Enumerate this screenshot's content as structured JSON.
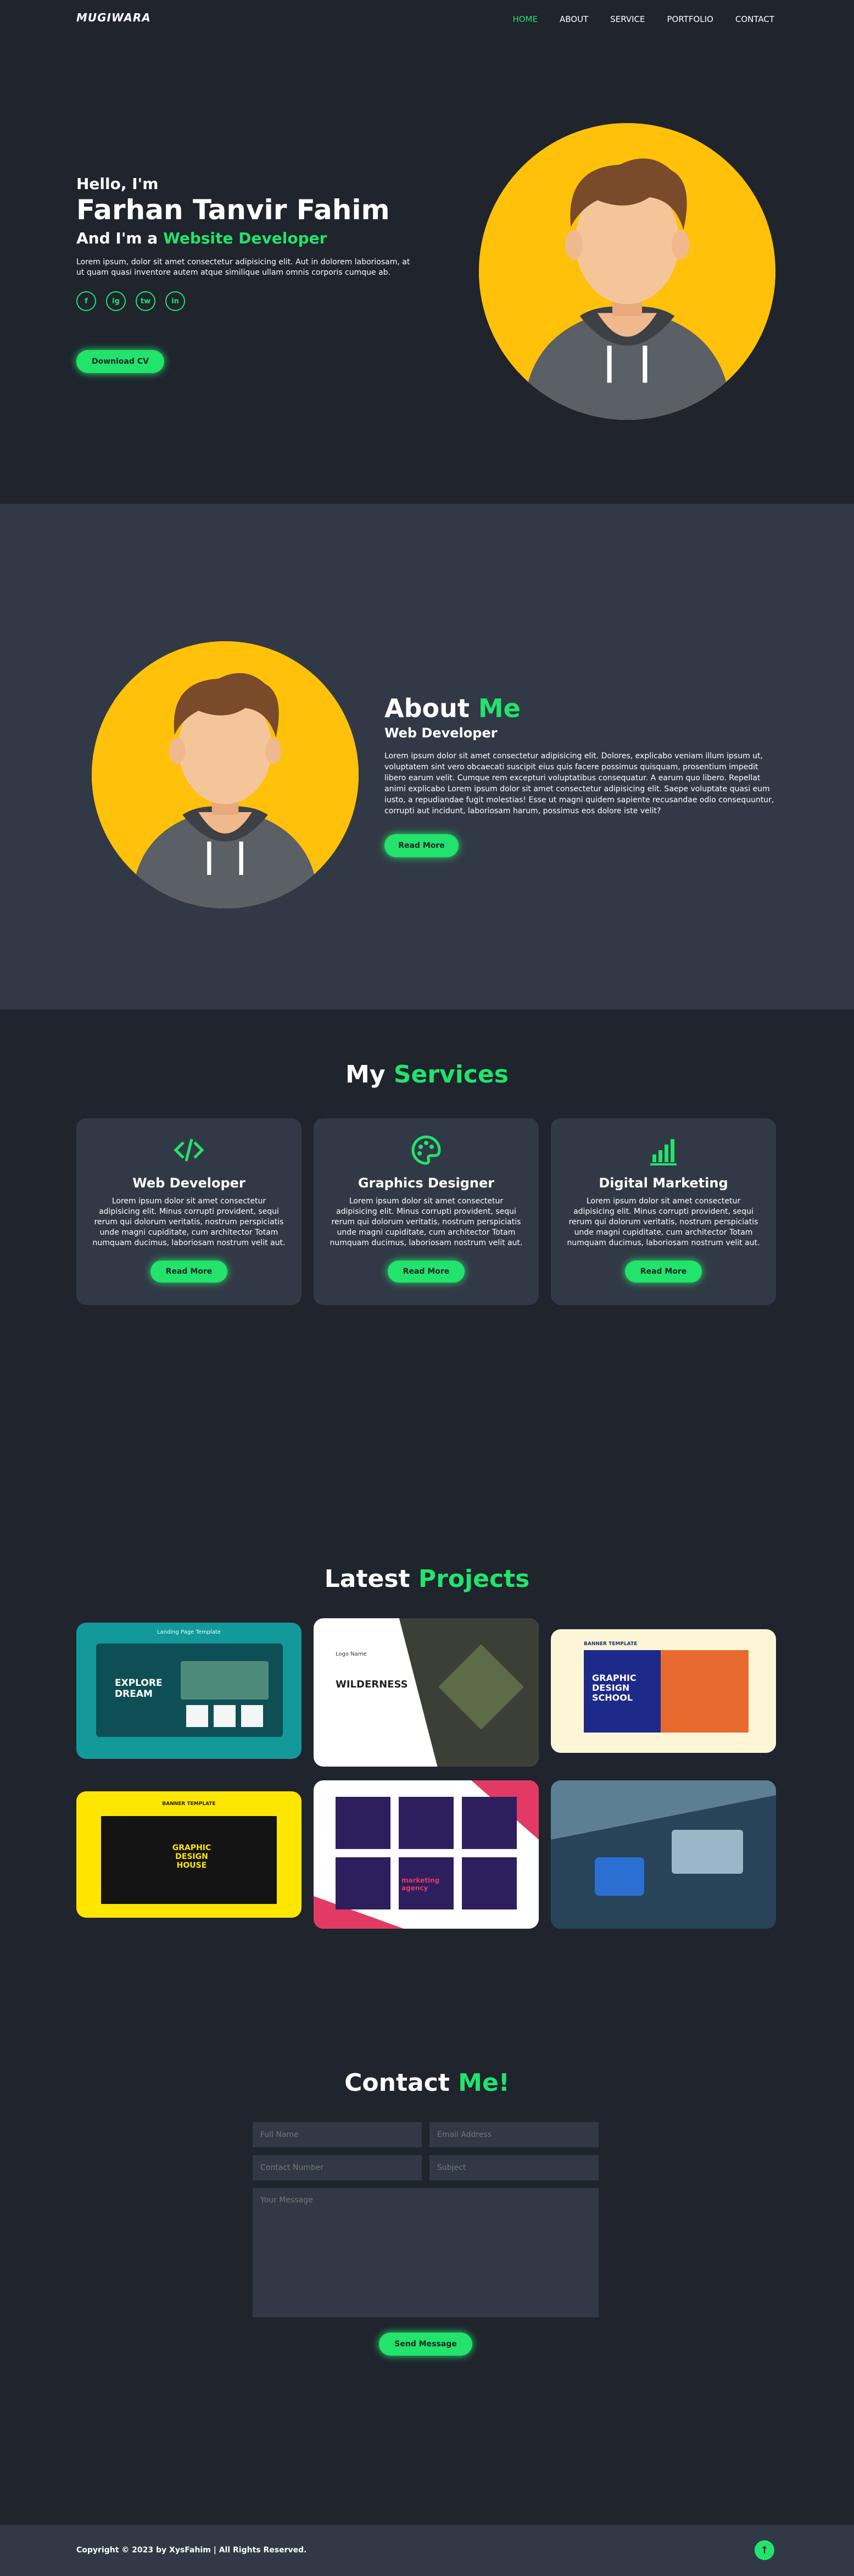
{
  "header": {
    "logo": "MUGIWARA",
    "nav": [
      "HOME",
      "ABOUT",
      "SERVICE",
      "PORTFOLIO",
      "CONTACT"
    ]
  },
  "hero": {
    "hello": "Hello, I'm",
    "name": "Farhan Tanvir Fahim",
    "role_prefix": "And I'm a",
    "role": "Website Developer",
    "description": "Lorem ipsum, dolor sit amet consectetur adipisicing elit. Aut in dolorem laboriosam, at ut quam quasi inventore autem atque similique ullam omnis corporis cumque ab.",
    "socials": [
      "f",
      "ig",
      "tw",
      "in"
    ],
    "cta": "Download CV"
  },
  "about": {
    "title_a": "About",
    "title_b": "Me",
    "subtitle": "Web Developer",
    "description": "Lorem ipsum dolor sit amet consectetur adipisicing elit. Dolores, explicabo veniam illum ipsum ut, voluptatem sint vero obcaecati suscipit eius quis facere possimus quisquam, prosentium impedit libero earum velit. Cumque rem excepturi voluptatibus consequatur. A earum quo libero. Repellat animi explicabo Lorem ipsum dolor sit amet consectetur adipisicing elit. Saepe voluptate quasi eum iusto, a repudiandae fugit molestias! Esse ut magni quidem sapiente recusandae odio consequuntur, corrupti aut incidunt, laboriosam harum, possimus eos dolore iste velit?",
    "cta": "Read More"
  },
  "services": {
    "title_a": "My",
    "title_b": "Services",
    "cards": [
      {
        "title": "Web Developer",
        "icon": "code-icon",
        "desc": "Lorem ipsum dolor sit amet consectetur adipisicing elit. Minus corrupti provident, sequi rerum qui dolorum veritatis, nostrum perspiciatis unde magni cupiditate, cum architector Totam numquam ducimus, laboriosam nostrum velit aut.",
        "cta": "Read More"
      },
      {
        "title": "Graphics Designer",
        "icon": "palette-icon",
        "desc": "Lorem ipsum dolor sit amet consectetur adipisicing elit. Minus corrupti provident, sequi rerum qui dolorum veritatis, nostrum perspiciatis unde magni cupiditate, cum architector Totam numquam ducimus, laboriosam nostrum velit aut.",
        "cta": "Read More"
      },
      {
        "title": "Digital Marketing",
        "icon": "signal-icon",
        "desc": "Lorem ipsum dolor sit amet consectetur adipisicing elit. Minus corrupti provident, sequi rerum qui dolorum veritatis, nostrum perspiciatis unde magni cupiditate, cum architector Totam numquam ducimus, laboriosam nostrum velit aut.",
        "cta": "Read More"
      }
    ]
  },
  "projects": {
    "title_a": "Latest",
    "title_b": "Projects",
    "items": [
      {
        "heading": "Landing Page Template",
        "text": "EXPLORE DREAM"
      },
      {
        "heading": "Logo Name",
        "text": "WILDERNESS"
      },
      {
        "heading": "BANNER TEMPLATE",
        "text": "GRAPHIC DESIGN SCHOOL"
      },
      {
        "heading": "BANNER TEMPLATE",
        "text": "GRAPHIC DESIGN HOUSE"
      },
      {
        "heading": "marketing agency",
        "text": "marketing agency"
      },
      {
        "heading": "",
        "text": ""
      }
    ]
  },
  "contact": {
    "title_a": "Contact",
    "title_b": "Me!",
    "full_name": "Full Name",
    "email": "Email Address",
    "number": "Contact Number",
    "subject": "Subject",
    "message": "Your Message",
    "cta": "Send Message"
  },
  "footer": {
    "copyright": "Copyright © 2023 by XysFahim | All Rights Reserved."
  },
  "colors": {
    "background": "#1f242d",
    "secondary": "#323946",
    "accent": "#22e36b",
    "avatar": "#ffc10a"
  }
}
